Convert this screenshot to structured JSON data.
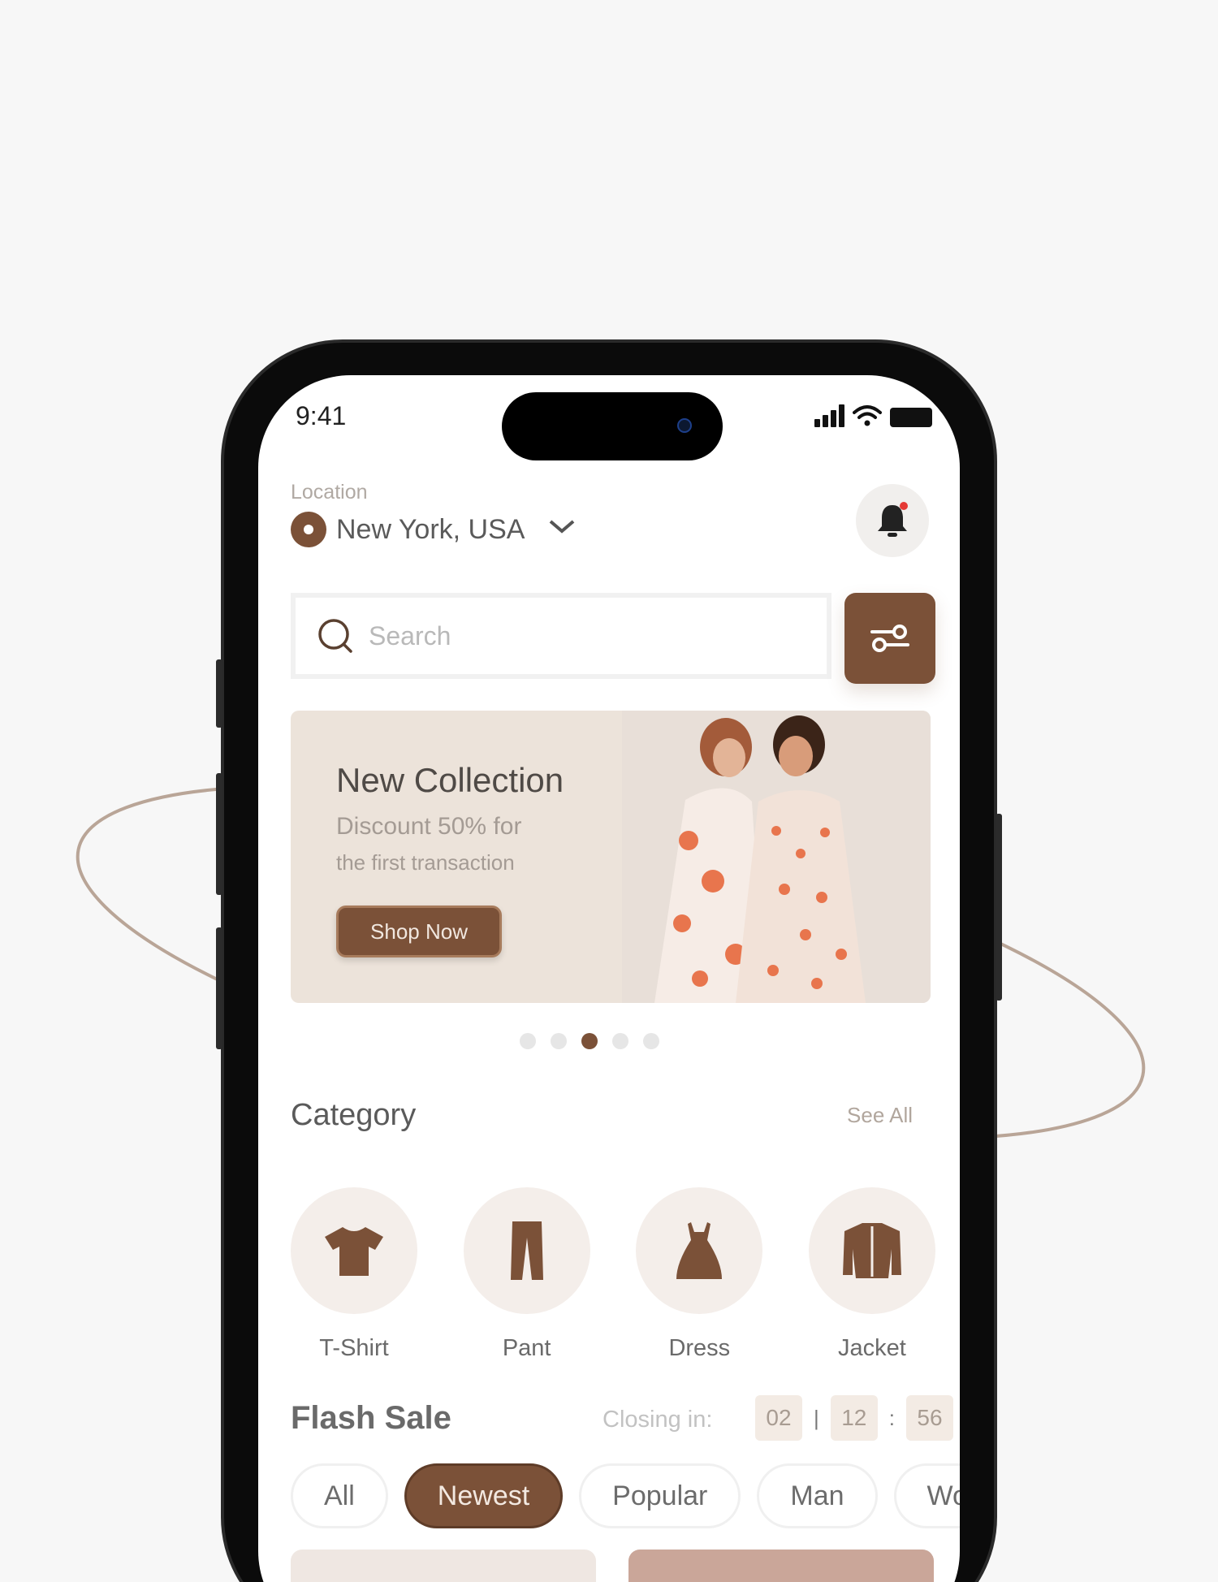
{
  "status": {
    "time": "9:41"
  },
  "location": {
    "label": "Location",
    "value": "New York, USA"
  },
  "search": {
    "placeholder": "Search"
  },
  "banner": {
    "title": "New Collection",
    "subtitle_line1": "Discount 50% for",
    "subtitle_line2": "the first transaction",
    "button": "Shop Now",
    "page_count": 5,
    "active_page": 3
  },
  "category": {
    "title": "Category",
    "see_all": "See All",
    "items": [
      {
        "label": "T-Shirt",
        "icon": "tshirt-icon"
      },
      {
        "label": "Pant",
        "icon": "pants-icon"
      },
      {
        "label": "Dress",
        "icon": "dress-icon"
      },
      {
        "label": "Jacket",
        "icon": "jacket-icon"
      }
    ]
  },
  "flash_sale": {
    "title": "Flash Sale",
    "closing_label": "Closing in:",
    "hours": "02",
    "minutes": "12",
    "seconds": "56",
    "sep1": "|",
    "sep2": ":"
  },
  "filters": [
    {
      "label": "All",
      "active": false
    },
    {
      "label": "Newest",
      "active": true
    },
    {
      "label": "Popular",
      "active": false
    },
    {
      "label": "Man",
      "active": false
    },
    {
      "label": "Wo",
      "active": false
    }
  ],
  "colors": {
    "accent": "#7b5138",
    "background": "#f7f7f7",
    "chip_bg": "#f4eeea"
  }
}
